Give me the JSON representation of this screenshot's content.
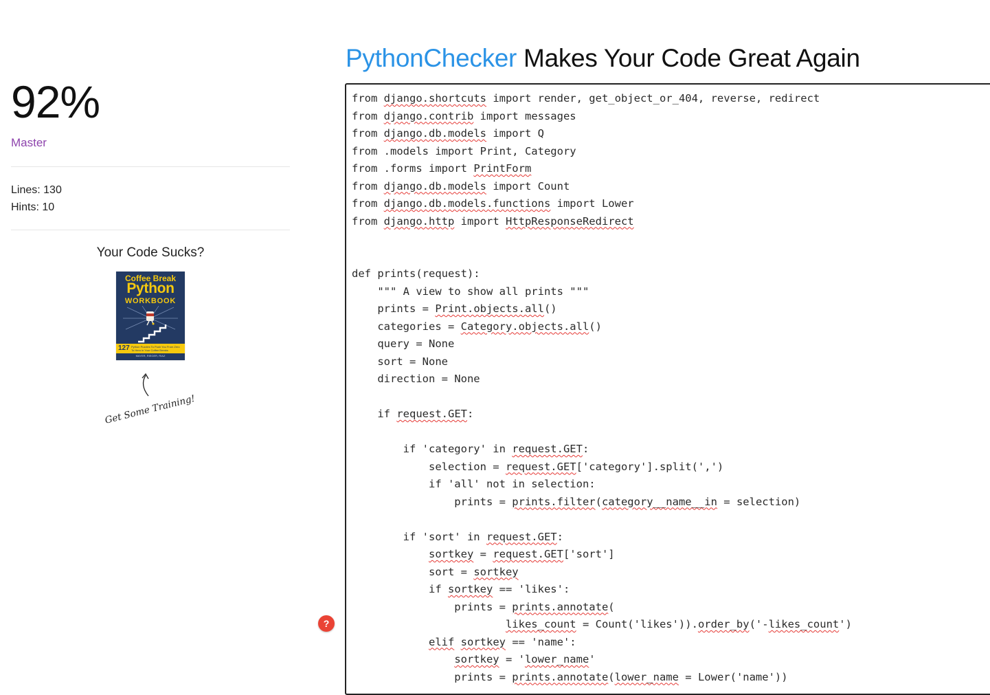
{
  "header": {
    "brand": "PythonChecker",
    "tagline": " Makes Your Code Great Again"
  },
  "sidebar": {
    "score": "92%",
    "level": "Master",
    "stats": {
      "lines": "Lines: 130",
      "hints": "Hints: 10"
    },
    "promo": {
      "title": "Your Code Sucks?",
      "book": {
        "line1": "Coffee Break",
        "line2": "Python",
        "line3": "WORKBOOK",
        "count": "127",
        "subtitle": "Python Puzzles To Push You From Zero To Hero in Your Coffee Breaks",
        "authors": "MAYER, RIEGER, RIAZ"
      },
      "cta": "Get Some Training!"
    }
  },
  "editor": {
    "lines": [
      [
        {
          "t": "from "
        },
        {
          "t": "django.shortcuts",
          "e": 1
        },
        {
          "t": " import render, get_object_or_404, reverse, redirect"
        }
      ],
      [
        {
          "t": "from "
        },
        {
          "t": "django.contrib",
          "e": 1
        },
        {
          "t": " import messages"
        }
      ],
      [
        {
          "t": "from "
        },
        {
          "t": "django.db.models",
          "e": 1
        },
        {
          "t": " import Q"
        }
      ],
      [
        {
          "t": "from .models import Print, Category"
        }
      ],
      [
        {
          "t": "from .forms import "
        },
        {
          "t": "PrintForm",
          "e": 1
        }
      ],
      [
        {
          "t": "from "
        },
        {
          "t": "django.db.models",
          "e": 1
        },
        {
          "t": " import Count"
        }
      ],
      [
        {
          "t": "from "
        },
        {
          "t": "django.db.models.functions",
          "e": 1
        },
        {
          "t": " import Lower"
        }
      ],
      [
        {
          "t": "from "
        },
        {
          "t": "django.http",
          "e": 1
        },
        {
          "t": " import "
        },
        {
          "t": "HttpResponseRedirect",
          "e": 1
        }
      ],
      [],
      [],
      [
        {
          "t": "def prints(request):"
        }
      ],
      [
        {
          "t": "    \"\"\" A view to show all prints \"\"\""
        }
      ],
      [
        {
          "t": "    prints = "
        },
        {
          "t": "Print.objects.all",
          "e": 1
        },
        {
          "t": "()"
        }
      ],
      [
        {
          "t": "    categories = "
        },
        {
          "t": "Category.objects.all",
          "e": 1
        },
        {
          "t": "()"
        }
      ],
      [
        {
          "t": "    query = None"
        }
      ],
      [
        {
          "t": "    sort = None"
        }
      ],
      [
        {
          "t": "    direction = None"
        }
      ],
      [],
      [
        {
          "t": "    if "
        },
        {
          "t": "request.GET",
          "e": 1
        },
        {
          "t": ":"
        }
      ],
      [],
      [
        {
          "t": "        if 'category' in "
        },
        {
          "t": "request.GET",
          "e": 1
        },
        {
          "t": ":"
        }
      ],
      [
        {
          "t": "            selection = "
        },
        {
          "t": "request.GET",
          "e": 1
        },
        {
          "t": "['category'].split(',')"
        }
      ],
      [
        {
          "t": "            if 'all' not in selection:"
        }
      ],
      [
        {
          "t": "                prints = "
        },
        {
          "t": "prints.filter",
          "e": 1
        },
        {
          "t": "("
        },
        {
          "t": "category__name__in",
          "e": 1
        },
        {
          "t": " = selection)"
        }
      ],
      [],
      [
        {
          "t": "        if 'sort' in "
        },
        {
          "t": "request.GET",
          "e": 1
        },
        {
          "t": ":"
        }
      ],
      [
        {
          "t": "            "
        },
        {
          "t": "sortkey",
          "e": 1
        },
        {
          "t": " = "
        },
        {
          "t": "request.GET",
          "e": 1
        },
        {
          "t": "['sort']"
        }
      ],
      [
        {
          "t": "            sort = "
        },
        {
          "t": "sortkey",
          "e": 1
        }
      ],
      [
        {
          "t": "            if "
        },
        {
          "t": "sortkey",
          "e": 1
        },
        {
          "t": " == 'likes':"
        }
      ],
      [
        {
          "t": "                prints = "
        },
        {
          "t": "prints.annotate",
          "e": 1
        },
        {
          "t": "("
        }
      ],
      [
        {
          "t": "                        "
        },
        {
          "t": "likes_count",
          "e": 1
        },
        {
          "t": " = Count('likes'))."
        },
        {
          "t": "order_by",
          "e": 1
        },
        {
          "t": "('-"
        },
        {
          "t": "likes_count",
          "e": 1
        },
        {
          "t": "')"
        }
      ],
      [
        {
          "t": "            "
        },
        {
          "t": "elif",
          "e": 1
        },
        {
          "t": " "
        },
        {
          "t": "sortkey",
          "e": 1
        },
        {
          "t": " == 'name':"
        }
      ],
      [
        {
          "t": "                "
        },
        {
          "t": "sortkey",
          "e": 1
        },
        {
          "t": " = '"
        },
        {
          "t": "lower_name",
          "e": 1
        },
        {
          "t": "'"
        }
      ],
      [
        {
          "t": "                prints = "
        },
        {
          "t": "prints.annotate",
          "e": 1
        },
        {
          "t": "("
        },
        {
          "t": "lower_name",
          "e": 1
        },
        {
          "t": " = Lower('name'))"
        }
      ]
    ]
  },
  "help_button": {
    "label": "?",
    "color": "#ea4335"
  },
  "colors": {
    "brand": "#2b93e6",
    "level": "#8e44ad",
    "squiggle": "#e53935",
    "book_cover": "#233a63",
    "book_accent": "#f6c90e"
  }
}
